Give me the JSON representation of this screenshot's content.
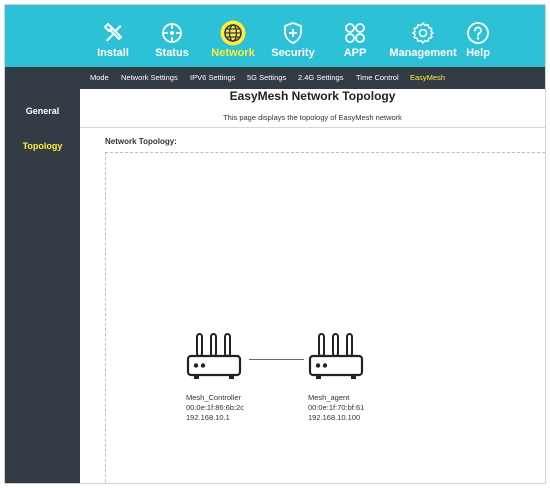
{
  "topnav": {
    "items": [
      {
        "label": "Install",
        "icon": "tools-icon"
      },
      {
        "label": "Status",
        "icon": "status-icon"
      },
      {
        "label": "Network",
        "icon": "globe-icon",
        "active": true
      },
      {
        "label": "Security",
        "icon": "shield-icon"
      },
      {
        "label": "APP",
        "icon": "apps-icon"
      },
      {
        "label": "Management",
        "icon": "gear-icon"
      },
      {
        "label": "Help",
        "icon": "help-icon"
      }
    ],
    "colors": {
      "bar": "#2cc1d7",
      "active_label": "#ffec3d",
      "active_icon_bg": "#ffec3d"
    }
  },
  "subnav": {
    "items": [
      {
        "label": "Mode"
      },
      {
        "label": "Network Settings"
      },
      {
        "label": "IPV6 Settings"
      },
      {
        "label": "5G Settings"
      },
      {
        "label": "2.4G Settings"
      },
      {
        "label": "Time Control"
      },
      {
        "label": "EasyMesh",
        "active": true
      }
    ]
  },
  "sidebar": {
    "items": [
      {
        "label": "General"
      },
      {
        "label": "Topology",
        "active": true
      }
    ]
  },
  "main": {
    "title": "EasyMesh Network Topology",
    "description": "This page displays the topology of EasyMesh network",
    "section_label": "Network Topology:",
    "devices": [
      {
        "name": "Mesh_Controller",
        "mac": "00:0e:1f:86:6b:2c",
        "ip": "192.168.10.1"
      },
      {
        "name": "Mesh_agent",
        "mac": "00:0e:1f:70:bf:61",
        "ip": "192.168.10.100"
      }
    ]
  }
}
